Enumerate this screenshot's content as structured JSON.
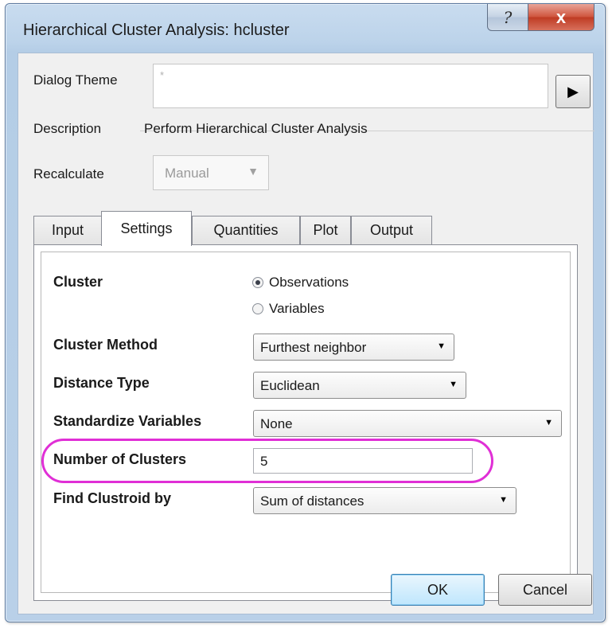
{
  "window": {
    "title": "Hierarchical Cluster Analysis: hcluster",
    "help_glyph": "?",
    "close_glyph": "x"
  },
  "dialog_theme": {
    "label": "Dialog Theme",
    "value": "*",
    "arrow_glyph": "▶"
  },
  "description": {
    "label": "Description",
    "value": "Perform Hierarchical Cluster Analysis"
  },
  "recalculate": {
    "label": "Recalculate",
    "value": "Manual"
  },
  "tabs": [
    {
      "label": "Input"
    },
    {
      "label": "Settings"
    },
    {
      "label": "Quantities"
    },
    {
      "label": "Plot"
    },
    {
      "label": "Output"
    }
  ],
  "active_tab": "Settings",
  "settings": {
    "cluster": {
      "label": "Cluster",
      "options": [
        "Observations",
        "Variables"
      ],
      "selected": "Observations"
    },
    "cluster_method": {
      "label": "Cluster Method",
      "value": "Furthest neighbor"
    },
    "distance_type": {
      "label": "Distance Type",
      "value": "Euclidean"
    },
    "standardize_variables": {
      "label": "Standardize Variables",
      "value": "None"
    },
    "number_of_clusters": {
      "label": "Number of Clusters",
      "value": "5"
    },
    "find_clustroid_by": {
      "label": "Find Clustroid by",
      "value": "Sum of distances"
    }
  },
  "buttons": {
    "ok": "OK",
    "cancel": "Cancel"
  },
  "colors": {
    "highlight": "#e02fd6",
    "frame": "#b9d0e8",
    "close_button": "#c9452e"
  }
}
